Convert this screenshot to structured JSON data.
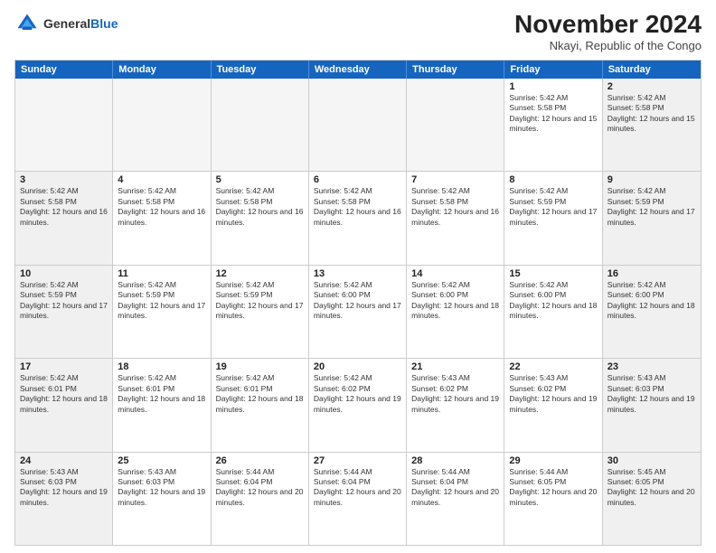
{
  "logo": {
    "general": "General",
    "blue": "Blue"
  },
  "header": {
    "month": "November 2024",
    "location": "Nkayi, Republic of the Congo"
  },
  "weekdays": [
    "Sunday",
    "Monday",
    "Tuesday",
    "Wednesday",
    "Thursday",
    "Friday",
    "Saturday"
  ],
  "rows": [
    [
      {
        "day": "",
        "info": "",
        "empty": true
      },
      {
        "day": "",
        "info": "",
        "empty": true
      },
      {
        "day": "",
        "info": "",
        "empty": true
      },
      {
        "day": "",
        "info": "",
        "empty": true
      },
      {
        "day": "",
        "info": "",
        "empty": true
      },
      {
        "day": "1",
        "info": "Sunrise: 5:42 AM\nSunset: 5:58 PM\nDaylight: 12 hours and 15 minutes."
      },
      {
        "day": "2",
        "info": "Sunrise: 5:42 AM\nSunset: 5:58 PM\nDaylight: 12 hours and 15 minutes."
      }
    ],
    [
      {
        "day": "3",
        "info": "Sunrise: 5:42 AM\nSunset: 5:58 PM\nDaylight: 12 hours and 16 minutes."
      },
      {
        "day": "4",
        "info": "Sunrise: 5:42 AM\nSunset: 5:58 PM\nDaylight: 12 hours and 16 minutes."
      },
      {
        "day": "5",
        "info": "Sunrise: 5:42 AM\nSunset: 5:58 PM\nDaylight: 12 hours and 16 minutes."
      },
      {
        "day": "6",
        "info": "Sunrise: 5:42 AM\nSunset: 5:58 PM\nDaylight: 12 hours and 16 minutes."
      },
      {
        "day": "7",
        "info": "Sunrise: 5:42 AM\nSunset: 5:58 PM\nDaylight: 12 hours and 16 minutes."
      },
      {
        "day": "8",
        "info": "Sunrise: 5:42 AM\nSunset: 5:59 PM\nDaylight: 12 hours and 17 minutes."
      },
      {
        "day": "9",
        "info": "Sunrise: 5:42 AM\nSunset: 5:59 PM\nDaylight: 12 hours and 17 minutes."
      }
    ],
    [
      {
        "day": "10",
        "info": "Sunrise: 5:42 AM\nSunset: 5:59 PM\nDaylight: 12 hours and 17 minutes."
      },
      {
        "day": "11",
        "info": "Sunrise: 5:42 AM\nSunset: 5:59 PM\nDaylight: 12 hours and 17 minutes."
      },
      {
        "day": "12",
        "info": "Sunrise: 5:42 AM\nSunset: 5:59 PM\nDaylight: 12 hours and 17 minutes."
      },
      {
        "day": "13",
        "info": "Sunrise: 5:42 AM\nSunset: 6:00 PM\nDaylight: 12 hours and 17 minutes."
      },
      {
        "day": "14",
        "info": "Sunrise: 5:42 AM\nSunset: 6:00 PM\nDaylight: 12 hours and 18 minutes."
      },
      {
        "day": "15",
        "info": "Sunrise: 5:42 AM\nSunset: 6:00 PM\nDaylight: 12 hours and 18 minutes."
      },
      {
        "day": "16",
        "info": "Sunrise: 5:42 AM\nSunset: 6:00 PM\nDaylight: 12 hours and 18 minutes."
      }
    ],
    [
      {
        "day": "17",
        "info": "Sunrise: 5:42 AM\nSunset: 6:01 PM\nDaylight: 12 hours and 18 minutes."
      },
      {
        "day": "18",
        "info": "Sunrise: 5:42 AM\nSunset: 6:01 PM\nDaylight: 12 hours and 18 minutes."
      },
      {
        "day": "19",
        "info": "Sunrise: 5:42 AM\nSunset: 6:01 PM\nDaylight: 12 hours and 18 minutes."
      },
      {
        "day": "20",
        "info": "Sunrise: 5:42 AM\nSunset: 6:02 PM\nDaylight: 12 hours and 19 minutes."
      },
      {
        "day": "21",
        "info": "Sunrise: 5:43 AM\nSunset: 6:02 PM\nDaylight: 12 hours and 19 minutes."
      },
      {
        "day": "22",
        "info": "Sunrise: 5:43 AM\nSunset: 6:02 PM\nDaylight: 12 hours and 19 minutes."
      },
      {
        "day": "23",
        "info": "Sunrise: 5:43 AM\nSunset: 6:03 PM\nDaylight: 12 hours and 19 minutes."
      }
    ],
    [
      {
        "day": "24",
        "info": "Sunrise: 5:43 AM\nSunset: 6:03 PM\nDaylight: 12 hours and 19 minutes."
      },
      {
        "day": "25",
        "info": "Sunrise: 5:43 AM\nSunset: 6:03 PM\nDaylight: 12 hours and 19 minutes."
      },
      {
        "day": "26",
        "info": "Sunrise: 5:44 AM\nSunset: 6:04 PM\nDaylight: 12 hours and 20 minutes."
      },
      {
        "day": "27",
        "info": "Sunrise: 5:44 AM\nSunset: 6:04 PM\nDaylight: 12 hours and 20 minutes."
      },
      {
        "day": "28",
        "info": "Sunrise: 5:44 AM\nSunset: 6:04 PM\nDaylight: 12 hours and 20 minutes."
      },
      {
        "day": "29",
        "info": "Sunrise: 5:44 AM\nSunset: 6:05 PM\nDaylight: 12 hours and 20 minutes."
      },
      {
        "day": "30",
        "info": "Sunrise: 5:45 AM\nSunset: 6:05 PM\nDaylight: 12 hours and 20 minutes."
      }
    ]
  ]
}
